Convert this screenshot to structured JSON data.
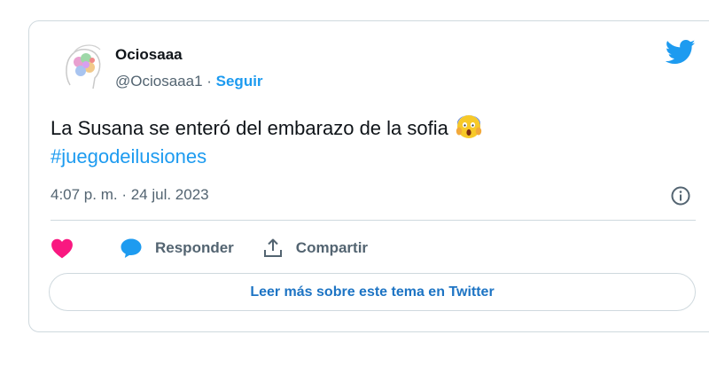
{
  "author": {
    "name": "Ociosaaa",
    "handle": "@Ociosaaa1",
    "separator": " · ",
    "follow_label": "Seguir"
  },
  "tweet": {
    "text": "La Susana se enteró del embarazo de la sofia",
    "emoji": "screaming-face-emoji",
    "hashtag": "#juegodeilusiones",
    "timestamp": "4:07 p. m. · 24 jul. 2023"
  },
  "actions": {
    "like_icon": "heart-icon",
    "reply_label": "Responder",
    "share_label": "Compartir"
  },
  "read_more_label": "Leer más sobre este tema en Twitter",
  "colors": {
    "accent": "#1d9bf0",
    "like": "#f91880",
    "muted": "#536471",
    "border": "#cfd9de"
  }
}
